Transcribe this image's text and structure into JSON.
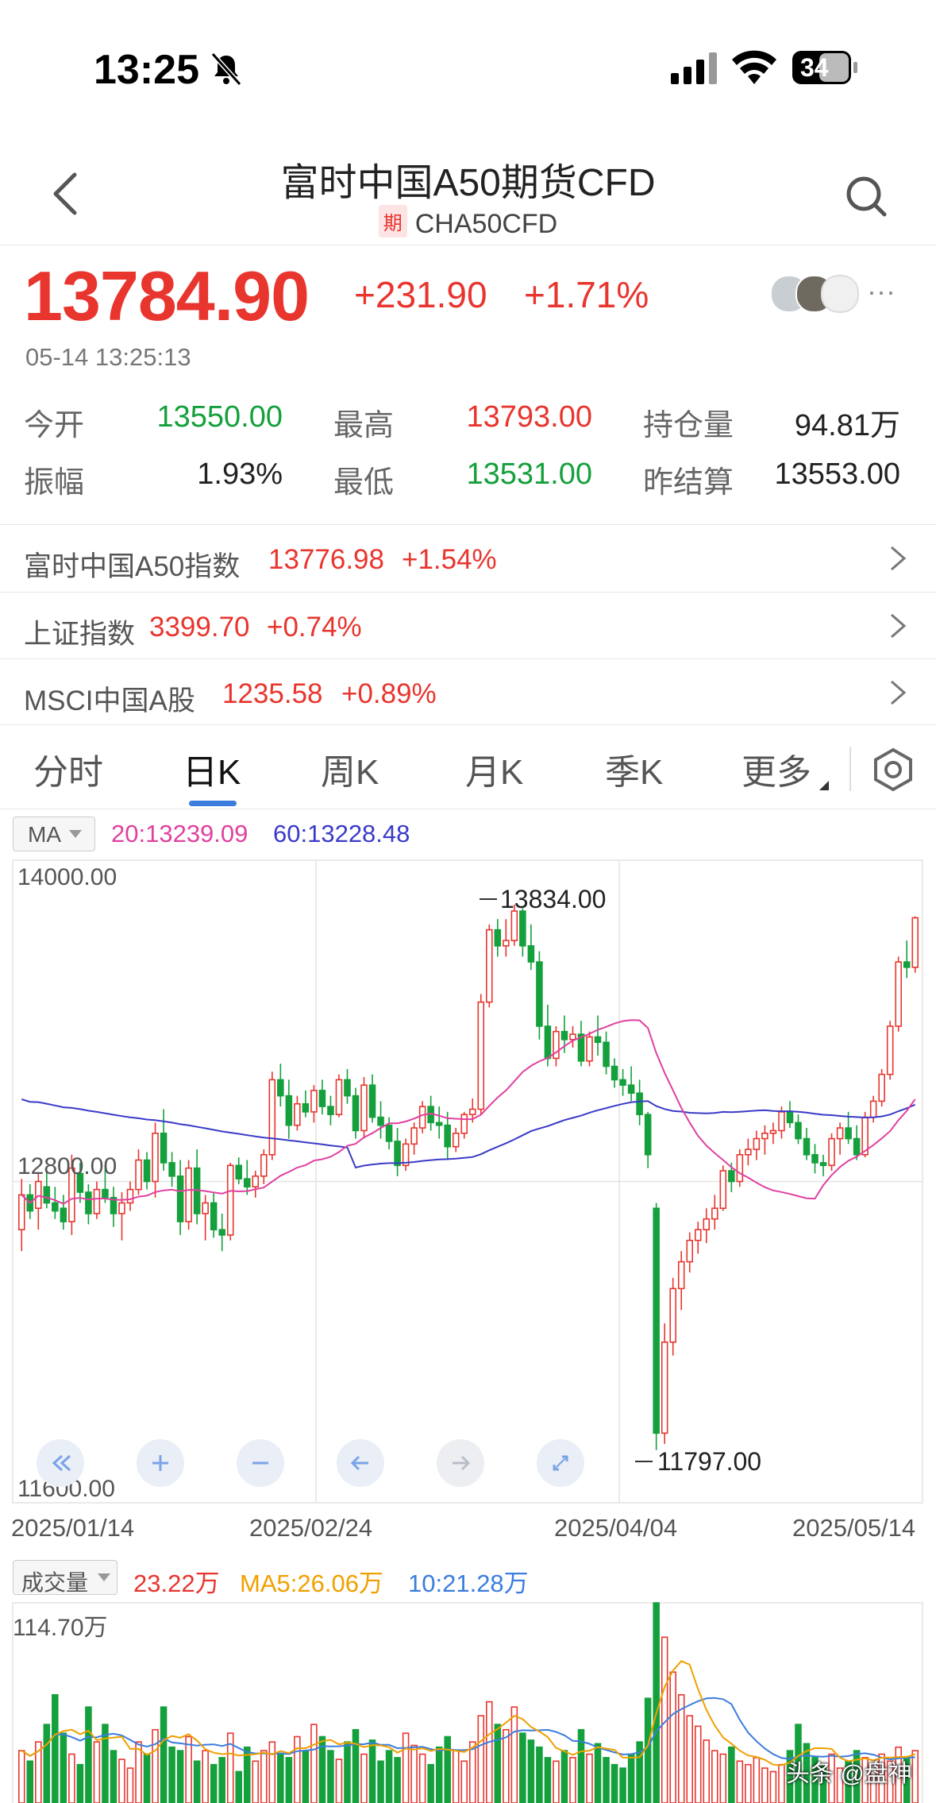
{
  "status_bar": {
    "time": "13:25",
    "battery": "34"
  },
  "header": {
    "title": "富时中国A50期货CFD",
    "badge": "期",
    "code": "CHA50CFD"
  },
  "quote": {
    "price": "13784.90",
    "change": "+231.90",
    "change_pct": "+1.71%",
    "timestamp": "05-14 13:25:13",
    "more": "···"
  },
  "stats": [
    {
      "label": "今开",
      "value": "13550.00",
      "color": "green"
    },
    {
      "label": "最高",
      "value": "13793.00",
      "color": "red"
    },
    {
      "label": "持仓量",
      "value": "94.81万",
      "color": "black"
    },
    {
      "label": "振幅",
      "value": "1.93%",
      "color": "black"
    },
    {
      "label": "最低",
      "value": "13531.00",
      "color": "green"
    },
    {
      "label": "昨结算",
      "value": "13553.00",
      "color": "black"
    }
  ],
  "related": [
    {
      "name": "富时中国A50指数",
      "value": "13776.98",
      "pct": "+1.54%"
    },
    {
      "name": "上证指数",
      "value": "3399.70",
      "pct": "+0.74%"
    },
    {
      "name": "MSCI中国A股",
      "value": "1235.58",
      "pct": "+0.89%"
    }
  ],
  "tabs": [
    "分时",
    "日K",
    "周K",
    "月K",
    "季K",
    "更多"
  ],
  "active_tab": "日K",
  "ma_legend": {
    "selector": "MA",
    "ma20": "20:13239.09",
    "ma60": "60:13228.48",
    "ma20_color": "#e040a0",
    "ma60_color": "#3a3ac8"
  },
  "price_axis": {
    "top": "14000.00",
    "mid": "12800.00",
    "bottom": "11600.00",
    "high_label": "13834.00",
    "low_label": "11797.00"
  },
  "date_axis": [
    "2025/01/14",
    "2025/02/24",
    "2025/04/04",
    "2025/05/14"
  ],
  "volume": {
    "selector": "成交量",
    "vol": "23.22万",
    "ma5": "MA5:26.06万",
    "ma10": "10:21.28万",
    "max": "114.70万"
  },
  "watermark": "头条 @盘神",
  "colors": {
    "up": "#e8352e",
    "down": "#14a03c",
    "accent": "#3b7ddd"
  },
  "chart_data": {
    "type": "candlestick",
    "x_range": [
      "2025/01/14",
      "2025/05/14"
    ],
    "ylim": [
      11600,
      14000
    ],
    "ohlc": [
      [
        12620,
        12810,
        12540,
        12750
      ],
      [
        12750,
        12790,
        12660,
        12690
      ],
      [
        12700,
        12830,
        12620,
        12800
      ],
      [
        12780,
        12840,
        12700,
        12720
      ],
      [
        12720,
        12780,
        12660,
        12690
      ],
      [
        12700,
        12750,
        12620,
        12650
      ],
      [
        12650,
        12900,
        12600,
        12850
      ],
      [
        12830,
        12870,
        12720,
        12760
      ],
      [
        12760,
        12790,
        12640,
        12680
      ],
      [
        12680,
        12800,
        12660,
        12770
      ],
      [
        12770,
        12860,
        12720,
        12740
      ],
      [
        12740,
        12780,
        12630,
        12680
      ],
      [
        12680,
        12760,
        12580,
        12720
      ],
      [
        12720,
        12800,
        12690,
        12770
      ],
      [
        12770,
        12920,
        12750,
        12880
      ],
      [
        12880,
        12910,
        12770,
        12800
      ],
      [
        12800,
        13020,
        12740,
        12980
      ],
      [
        12980,
        13070,
        12840,
        12870
      ],
      [
        12870,
        12910,
        12780,
        12820
      ],
      [
        12820,
        12880,
        12600,
        12650
      ],
      [
        12650,
        12880,
        12620,
        12850
      ],
      [
        12850,
        12920,
        12640,
        12680
      ],
      [
        12680,
        12750,
        12580,
        12720
      ],
      [
        12720,
        12760,
        12590,
        12620
      ],
      [
        12620,
        12680,
        12540,
        12600
      ],
      [
        12600,
        12870,
        12580,
        12860
      ],
      [
        12860,
        12890,
        12790,
        12810
      ],
      [
        12810,
        12880,
        12750,
        12780
      ],
      [
        12780,
        12840,
        12740,
        12820
      ],
      [
        12820,
        12920,
        12790,
        12900
      ],
      [
        12900,
        13210,
        12880,
        13180
      ],
      [
        13180,
        13240,
        13080,
        13120
      ],
      [
        13120,
        13180,
        12960,
        13010
      ],
      [
        13010,
        13120,
        12990,
        13090
      ],
      [
        13090,
        13140,
        13040,
        13060
      ],
      [
        13060,
        13160,
        13020,
        13140
      ],
      [
        13140,
        13180,
        13050,
        13080
      ],
      [
        13080,
        13120,
        13010,
        13050
      ],
      [
        13050,
        13200,
        13040,
        13180
      ],
      [
        13180,
        13220,
        13090,
        13120
      ],
      [
        13120,
        13150,
        12960,
        12990
      ],
      [
        12990,
        13190,
        12960,
        13160
      ],
      [
        13160,
        13200,
        13020,
        13040
      ],
      [
        13040,
        13100,
        12960,
        13010
      ],
      [
        13010,
        13040,
        12920,
        12950
      ],
      [
        12950,
        13000,
        12820,
        12860
      ],
      [
        12860,
        12960,
        12840,
        12940
      ],
      [
        12940,
        13020,
        12900,
        13000
      ],
      [
        13000,
        13100,
        12980,
        13080
      ],
      [
        13080,
        13120,
        12990,
        13020
      ],
      [
        13020,
        13080,
        12960,
        13010
      ],
      [
        13010,
        13060,
        12880,
        12930
      ],
      [
        12930,
        13000,
        12910,
        12980
      ],
      [
        12980,
        13060,
        12960,
        13050
      ],
      [
        13050,
        13110,
        13020,
        13070
      ],
      [
        13070,
        13500,
        13050,
        13470
      ],
      [
        13470,
        13760,
        13450,
        13740
      ],
      [
        13740,
        13780,
        13640,
        13680
      ],
      [
        13680,
        13780,
        13640,
        13700
      ],
      [
        13700,
        13834,
        13680,
        13810
      ],
      [
        13810,
        13820,
        13640,
        13680
      ],
      [
        13680,
        13760,
        13590,
        13620
      ],
      [
        13620,
        13660,
        13330,
        13380
      ],
      [
        13380,
        13460,
        13230,
        13260
      ],
      [
        13260,
        13380,
        13230,
        13360
      ],
      [
        13360,
        13420,
        13280,
        13330
      ],
      [
        13330,
        13380,
        13300,
        13350
      ],
      [
        13350,
        13400,
        13230,
        13250
      ],
      [
        13250,
        13360,
        13230,
        13340
      ],
      [
        13340,
        13420,
        13270,
        13320
      ],
      [
        13320,
        13360,
        13200,
        13230
      ],
      [
        13230,
        13260,
        13150,
        13180
      ],
      [
        13180,
        13220,
        13120,
        13160
      ],
      [
        13160,
        13230,
        13100,
        13130
      ],
      [
        13130,
        13180,
        13010,
        13050
      ],
      [
        13050,
        13060,
        12850,
        12900
      ],
      [
        12700,
        12720,
        11797,
        11860
      ],
      [
        11860,
        12270,
        11820,
        12200
      ],
      [
        12200,
        12440,
        12150,
        12400
      ],
      [
        12400,
        12540,
        12320,
        12500
      ],
      [
        12500,
        12610,
        12460,
        12580
      ],
      [
        12580,
        12650,
        12530,
        12620
      ],
      [
        12620,
        12700,
        12570,
        12660
      ],
      [
        12660,
        12750,
        12620,
        12700
      ],
      [
        12700,
        12860,
        12690,
        12840
      ],
      [
        12840,
        12870,
        12760,
        12800
      ],
      [
        12800,
        12920,
        12780,
        12900
      ],
      [
        12900,
        12960,
        12860,
        12920
      ],
      [
        12920,
        12990,
        12880,
        12960
      ],
      [
        12960,
        13010,
        12900,
        12980
      ],
      [
        12980,
        13020,
        12940,
        12990
      ],
      [
        12990,
        13080,
        12960,
        13060
      ],
      [
        13060,
        13100,
        13000,
        13020
      ],
      [
        13020,
        13050,
        12940,
        12960
      ],
      [
        12960,
        13000,
        12880,
        12900
      ],
      [
        12900,
        12940,
        12830,
        12870
      ],
      [
        12870,
        12900,
        12820,
        12860
      ],
      [
        12860,
        12980,
        12840,
        12960
      ],
      [
        12960,
        13020,
        12900,
        13000
      ],
      [
        13000,
        13060,
        12940,
        12960
      ],
      [
        12960,
        13010,
        12880,
        12900
      ],
      [
        12900,
        13060,
        12890,
        13040
      ],
      [
        13040,
        13120,
        13020,
        13100
      ],
      [
        13100,
        13220,
        13080,
        13200
      ],
      [
        13200,
        13400,
        13180,
        13380
      ],
      [
        13380,
        13640,
        13360,
        13620
      ],
      [
        13620,
        13700,
        13560,
        13600
      ],
      [
        13600,
        13790,
        13580,
        13784.9
      ]
    ],
    "volume_ylim": [
      0,
      114.7
    ],
    "volume": [
      30,
      24,
      35,
      45,
      62,
      40,
      28,
      22,
      55,
      35,
      45,
      30,
      25,
      20,
      35,
      28,
      42,
      55,
      32,
      30,
      38,
      24,
      30,
      22,
      26,
      40,
      18,
      32,
      24,
      30,
      35,
      28,
      26,
      38,
      30,
      45,
      38,
      30,
      25,
      35,
      42,
      28,
      36,
      24,
      30,
      26,
      40,
      33,
      28,
      22,
      32,
      38,
      30,
      24,
      35,
      50,
      58,
      45,
      42,
      55,
      40,
      36,
      32,
      26,
      24,
      30,
      26,
      42,
      28,
      34,
      26,
      22,
      20,
      28,
      35,
      60,
      114.7,
      95,
      75,
      62,
      50,
      44,
      36,
      30,
      28,
      32,
      24,
      22,
      26,
      20,
      18,
      22,
      30,
      45,
      34,
      26,
      22,
      28,
      20,
      24,
      30,
      26,
      22,
      28,
      24,
      32,
      26,
      30,
      22,
      24
    ]
  }
}
